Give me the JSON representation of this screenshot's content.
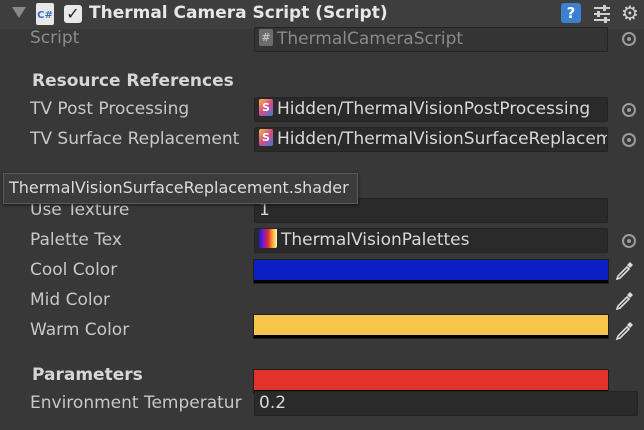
{
  "component": {
    "title": "Thermal Camera Script (Script)",
    "icon": "csharp-script-icon",
    "enabled": true
  },
  "script_field": {
    "label": "Script",
    "value": "ThermalCameraScript"
  },
  "resource_references": {
    "heading": "Resource References",
    "rows": [
      {
        "label": "TV Post Processing",
        "value": "Hidden/ThermalVisionPostProcessing"
      },
      {
        "label": "TV Surface Replacement",
        "value": "Hidden/ThermalVisionSurfaceReplacement"
      }
    ]
  },
  "tooltip": {
    "text": "ThermalVisionSurfaceReplacement.shader"
  },
  "use_texture": {
    "label": "Use Texture",
    "value": "1"
  },
  "palette_tex": {
    "label": "Palette Tex",
    "value": "ThermalVisionPalettes"
  },
  "colors": [
    {
      "label": "Cool Color",
      "hex": "#0a20c4"
    },
    {
      "label": "Mid Color",
      "hex": "#f5c64b"
    },
    {
      "label": "Warm Color",
      "hex": "#e3322a"
    }
  ],
  "parameters": {
    "heading": "Parameters",
    "environment_temperature": {
      "label": "Environment Temperatur",
      "value": "0.2"
    }
  }
}
